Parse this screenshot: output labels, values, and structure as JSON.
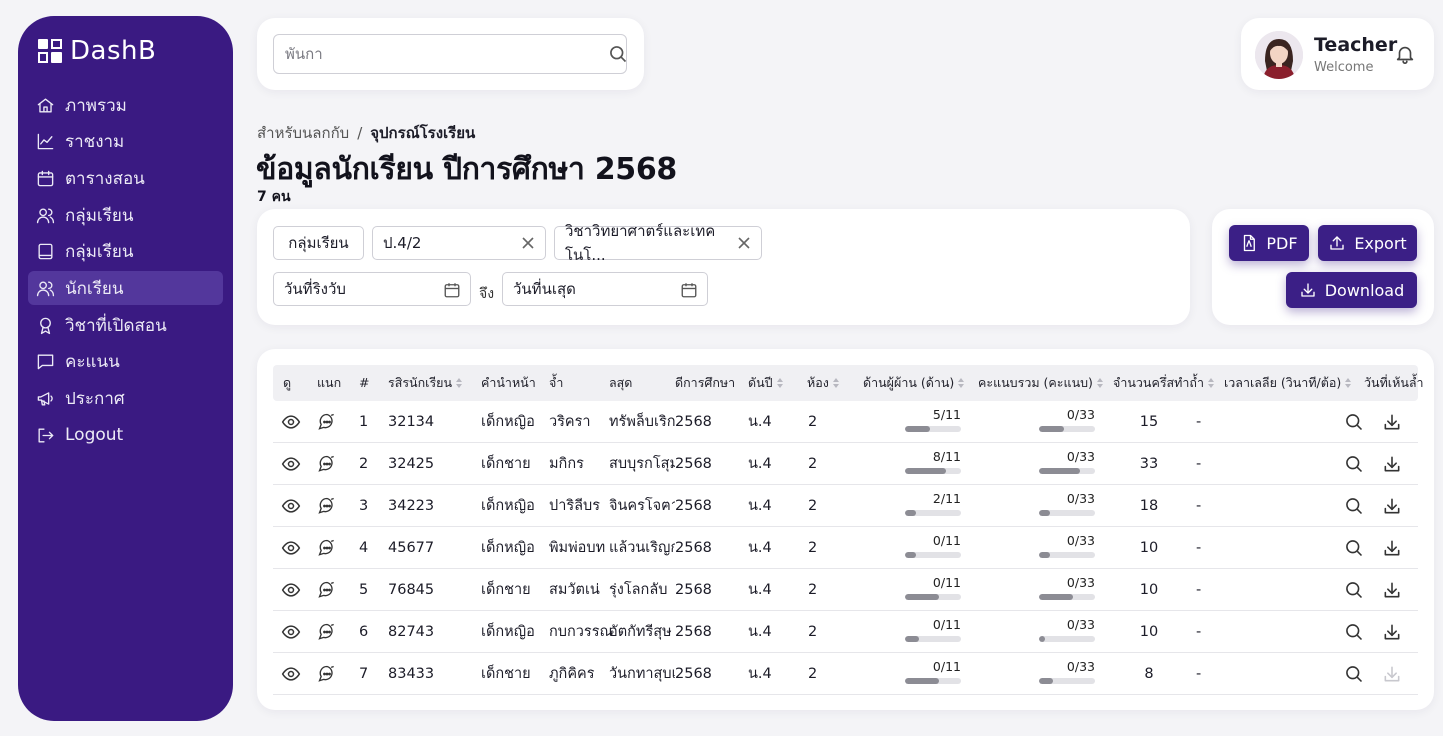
{
  "brand": {
    "name": "DashB"
  },
  "nav": [
    {
      "label": "ภาพรวม",
      "icon": "home-icon",
      "active": false
    },
    {
      "label": "ราชงาม",
      "icon": "chart-line-icon",
      "active": false
    },
    {
      "label": "ตารางสอน",
      "icon": "calendar-icon",
      "active": false
    },
    {
      "label": "กลุ่มเรียน",
      "icon": "users-icon",
      "active": false
    },
    {
      "label": "กลุ่มเรียน",
      "icon": "book-icon",
      "active": false
    },
    {
      "label": "นักเรียน",
      "icon": "users-icon",
      "active": true
    },
    {
      "label": "วิชาที่เปิดสอน",
      "icon": "award-icon",
      "active": false
    },
    {
      "label": "คะแนน",
      "icon": "message-square-icon",
      "active": false
    },
    {
      "label": "ประกาศ",
      "icon": "megaphone-icon",
      "active": false
    },
    {
      "label": "Logout",
      "icon": "logout-icon",
      "active": false
    }
  ],
  "search": {
    "placeholder": "พันกา"
  },
  "user": {
    "name": "Teacher",
    "subtitle": "Welcome"
  },
  "breadcrumb": {
    "parent": "สำหรับนลกกับ",
    "separator": "/",
    "current": "จุปกรณ์โรงเรียน"
  },
  "page": {
    "title": "ข้อมูลนักเรียน ปีการศึกษา 2568",
    "count": "7 คน"
  },
  "filters": {
    "group_label": "กลุ่มเรียน",
    "class_value": "ป.4/2",
    "subject_value": "วิชาวิทยาศาตร์และเทคโนโ...",
    "date_start_placeholder": "วันที่ริงวับ",
    "to_label": "จึง",
    "date_end_placeholder": "วันที่นเสุด"
  },
  "actions": {
    "pdf": "PDF",
    "export": "Export",
    "download": "Download"
  },
  "table": {
    "headers": {
      "view": "ดู",
      "chat": "แนก",
      "index": "#",
      "student_id": "รสิรนักเรียน",
      "prefix": "คำนำหน้า",
      "first_name": "จ้ำ",
      "last_name": "ลสุด",
      "year": "ดีการศึกษา",
      "grade": "ดันปี",
      "room": "ห้อง",
      "homework": "ด้านผู้ผ้าน (ด้าน)",
      "score": "คะแนบรวม (คะแนบ)",
      "attempts": "จำนวนครึ่สทำถ้ำ",
      "time": "เวลาเลลีย (วินาที/ต้อ)",
      "date": "วันที่เห้นล้ำ"
    },
    "rows": [
      {
        "index": "1",
        "student_id": "32134",
        "prefix": "เด็กหญิอ",
        "first_name": "วริครา",
        "last_name": "ทรัพล็บเริกฎ",
        "year": "2568",
        "grade": "น.4",
        "room": "2",
        "homework_label": "5/11",
        "homework_fraction": 0.45,
        "score_label": "0/33",
        "score_fraction": 0.45,
        "attempts": "15",
        "time": "-",
        "download_enabled": true
      },
      {
        "index": "2",
        "student_id": "32425",
        "prefix": "เด็กชาย",
        "first_name": "มกิกร",
        "last_name": "สบบุรกโสุม",
        "year": "2568",
        "grade": "น.4",
        "room": "2",
        "homework_label": "8/11",
        "homework_fraction": 0.73,
        "score_label": "0/33",
        "score_fraction": 0.73,
        "attempts": "33",
        "time": "-",
        "download_enabled": true
      },
      {
        "index": "3",
        "student_id": "34223",
        "prefix": "เด็กหญิอ",
        "first_name": "ปาริลีบร",
        "last_name": "จินครโจฅา",
        "year": "2568",
        "grade": "น.4",
        "room": "2",
        "homework_label": "2/11",
        "homework_fraction": 0.2,
        "score_label": "0/33",
        "score_fraction": 0.2,
        "attempts": "18",
        "time": "-",
        "download_enabled": true
      },
      {
        "index": "4",
        "student_id": "45677",
        "prefix": "เด็กหญิอ",
        "first_name": "พิมพ่อบท",
        "last_name": "แล้วนเริญกก",
        "year": "2568",
        "grade": "น.4",
        "room": "2",
        "homework_label": "0/11",
        "homework_fraction": 0.2,
        "score_label": "0/33",
        "score_fraction": 0.2,
        "attempts": "10",
        "time": "-",
        "download_enabled": true
      },
      {
        "index": "5",
        "student_id": "76845",
        "prefix": "เด็กชาย",
        "first_name": "สมวัตเน่",
        "last_name": "รุ่งโลกลับ",
        "year": "2568",
        "grade": "น.4",
        "room": "2",
        "homework_label": "0/11",
        "homework_fraction": 0.6,
        "score_label": "0/33",
        "score_fraction": 0.6,
        "attempts": "10",
        "time": "-",
        "download_enabled": true
      },
      {
        "index": "6",
        "student_id": "82743",
        "prefix": "เด็กหญิอ",
        "first_name": "กบกวรรณ",
        "last_name": "อัตกัทรีสุษ",
        "year": "2568",
        "grade": "น.4",
        "room": "2",
        "homework_label": "0/11",
        "homework_fraction": 0.25,
        "score_label": "0/33",
        "score_fraction": 0.1,
        "attempts": "10",
        "time": "-",
        "download_enabled": true
      },
      {
        "index": "7",
        "student_id": "83433",
        "prefix": "เด็กชาย",
        "first_name": "ภูกิคิคร",
        "last_name": "วันกทาสุบเกน",
        "year": "2568",
        "grade": "น.4",
        "room": "2",
        "homework_label": "0/11",
        "homework_fraction": 0.6,
        "score_label": "0/33",
        "score_fraction": 0.25,
        "attempts": "8",
        "time": "-",
        "download_enabled": false
      }
    ]
  },
  "colors": {
    "sidebar": "#3a1a82",
    "active_item": "#53379c",
    "button": "#3b1f86",
    "progress_fill": "#8c8c94"
  }
}
